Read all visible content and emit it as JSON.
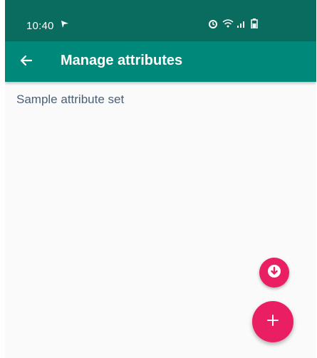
{
  "status_bar": {
    "time": "10:40",
    "icons": [
      "flag-icon",
      "alarm-icon",
      "wifi-icon",
      "signal-icon",
      "battery-icon"
    ]
  },
  "app_bar": {
    "title": "Manage attributes",
    "back_icon": "arrow-left-icon"
  },
  "list": {
    "items": [
      {
        "label": "Sample attribute set"
      }
    ]
  },
  "fabs": {
    "download_icon": "download-icon",
    "add_icon": "plus-icon"
  },
  "colors": {
    "status_bar": "#0a6b5f",
    "app_bar": "#00897b",
    "accent": "#e91e63",
    "background": "#fafafa",
    "list_text": "#4a5f76"
  }
}
